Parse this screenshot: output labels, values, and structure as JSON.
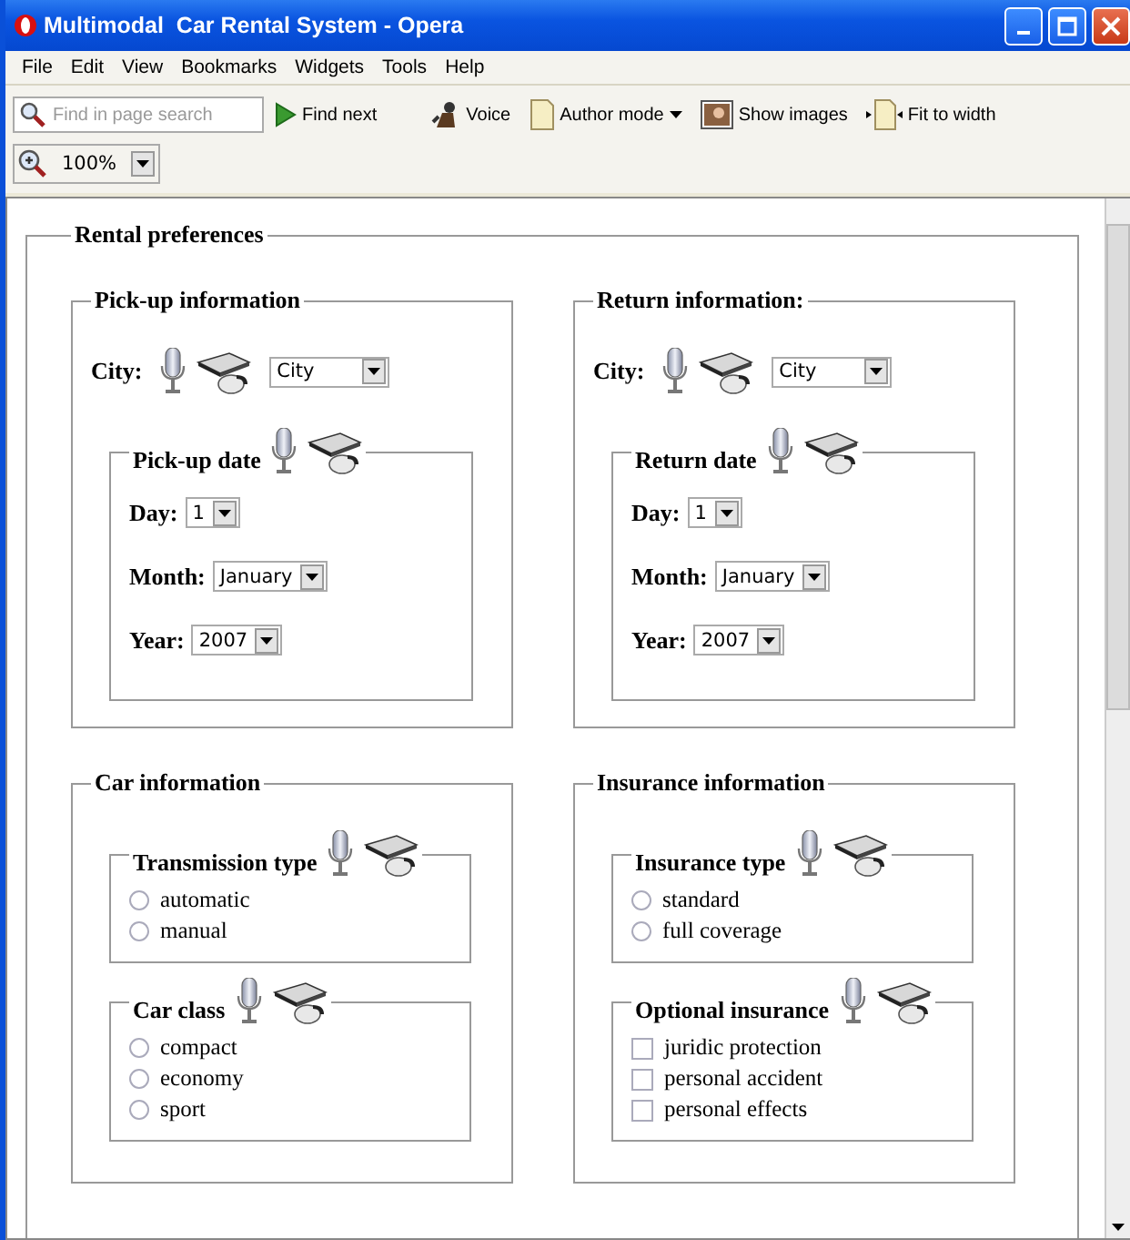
{
  "window": {
    "title": "Multimodal  Car Rental System - Opera"
  },
  "menu": [
    "File",
    "Edit",
    "View",
    "Bookmarks",
    "Widgets",
    "Tools",
    "Help"
  ],
  "toolbar": {
    "search": {
      "placeholder": "Find in page search"
    },
    "buttons": [
      {
        "kind": "find",
        "label": "Find next",
        "dropdown": false
      },
      {
        "kind": "voice",
        "label": "Voice",
        "dropdown": false
      },
      {
        "kind": "author",
        "label": "Author mode",
        "dropdown": true
      },
      {
        "kind": "images",
        "label": "Show images",
        "dropdown": false
      },
      {
        "kind": "fit",
        "label": "Fit to width",
        "dropdown": false
      }
    ],
    "zoom": {
      "value": "100%"
    }
  },
  "form": {
    "legend": "Rental preferences",
    "sections": [
      {
        "legend": "Pick-up information",
        "items": [
          {
            "kind": "select",
            "label": "City:",
            "value": "City"
          },
          {
            "kind": "group",
            "legend": "Pick-up date",
            "items": [
              {
                "kind": "select",
                "label": "Day:",
                "value": "1"
              },
              {
                "kind": "select",
                "label": "Month:",
                "value": "January"
              },
              {
                "kind": "select",
                "label": "Year:",
                "value": "2007"
              }
            ]
          }
        ]
      },
      {
        "legend": "Return information:",
        "items": [
          {
            "kind": "select",
            "label": "City:",
            "value": "City"
          },
          {
            "kind": "group",
            "legend": "Return date",
            "items": [
              {
                "kind": "select",
                "label": "Day:",
                "value": "1"
              },
              {
                "kind": "select",
                "label": "Month:",
                "value": "January"
              },
              {
                "kind": "select",
                "label": "Year:",
                "value": "2007"
              }
            ]
          }
        ]
      },
      {
        "legend": "Car information",
        "items": [
          {
            "kind": "options",
            "legend": "Transmission type",
            "items": [
              {
                "kind": "radio",
                "label": "automatic",
                "checked": false
              },
              {
                "kind": "radio",
                "label": "manual",
                "checked": false
              }
            ]
          },
          {
            "kind": "options",
            "legend": "Car class",
            "items": [
              {
                "kind": "radio",
                "label": "compact",
                "checked": false
              },
              {
                "kind": "radio",
                "label": "economy",
                "checked": false
              },
              {
                "kind": "radio",
                "label": "sport",
                "checked": false
              }
            ]
          }
        ]
      },
      {
        "legend": "Insurance information",
        "items": [
          {
            "kind": "options",
            "legend": "Insurance type",
            "items": [
              {
                "kind": "radio",
                "label": "standard",
                "checked": false
              },
              {
                "kind": "radio",
                "label": "full coverage",
                "checked": false
              }
            ]
          },
          {
            "kind": "options",
            "legend": "Optional insurance",
            "items": [
              {
                "kind": "checkbox",
                "label": "juridic protection",
                "checked": false
              },
              {
                "kind": "checkbox",
                "label": "personal accident",
                "checked": false
              },
              {
                "kind": "checkbox",
                "label": "personal effects",
                "checked": false
              }
            ]
          }
        ]
      }
    ]
  }
}
